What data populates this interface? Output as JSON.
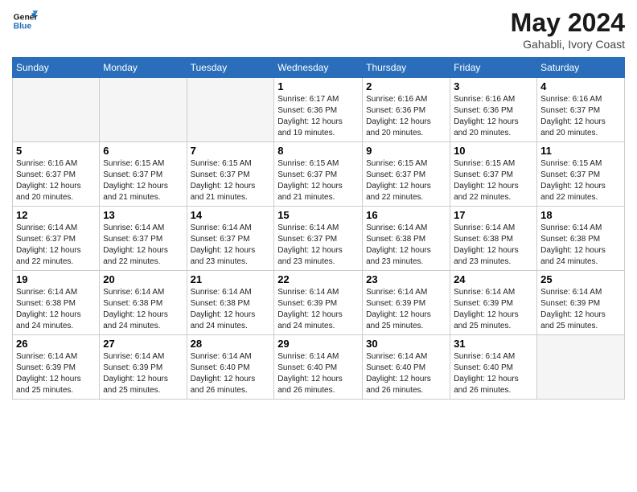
{
  "header": {
    "logo_line1": "General",
    "logo_line2": "Blue",
    "month": "May 2024",
    "location": "Gahabli, Ivory Coast"
  },
  "weekdays": [
    "Sunday",
    "Monday",
    "Tuesday",
    "Wednesday",
    "Thursday",
    "Friday",
    "Saturday"
  ],
  "weeks": [
    [
      {
        "day": "",
        "info": ""
      },
      {
        "day": "",
        "info": ""
      },
      {
        "day": "",
        "info": ""
      },
      {
        "day": "1",
        "info": "Sunrise: 6:17 AM\nSunset: 6:36 PM\nDaylight: 12 hours\nand 19 minutes."
      },
      {
        "day": "2",
        "info": "Sunrise: 6:16 AM\nSunset: 6:36 PM\nDaylight: 12 hours\nand 20 minutes."
      },
      {
        "day": "3",
        "info": "Sunrise: 6:16 AM\nSunset: 6:36 PM\nDaylight: 12 hours\nand 20 minutes."
      },
      {
        "day": "4",
        "info": "Sunrise: 6:16 AM\nSunset: 6:37 PM\nDaylight: 12 hours\nand 20 minutes."
      }
    ],
    [
      {
        "day": "5",
        "info": "Sunrise: 6:16 AM\nSunset: 6:37 PM\nDaylight: 12 hours\nand 20 minutes."
      },
      {
        "day": "6",
        "info": "Sunrise: 6:15 AM\nSunset: 6:37 PM\nDaylight: 12 hours\nand 21 minutes."
      },
      {
        "day": "7",
        "info": "Sunrise: 6:15 AM\nSunset: 6:37 PM\nDaylight: 12 hours\nand 21 minutes."
      },
      {
        "day": "8",
        "info": "Sunrise: 6:15 AM\nSunset: 6:37 PM\nDaylight: 12 hours\nand 21 minutes."
      },
      {
        "day": "9",
        "info": "Sunrise: 6:15 AM\nSunset: 6:37 PM\nDaylight: 12 hours\nand 22 minutes."
      },
      {
        "day": "10",
        "info": "Sunrise: 6:15 AM\nSunset: 6:37 PM\nDaylight: 12 hours\nand 22 minutes."
      },
      {
        "day": "11",
        "info": "Sunrise: 6:15 AM\nSunset: 6:37 PM\nDaylight: 12 hours\nand 22 minutes."
      }
    ],
    [
      {
        "day": "12",
        "info": "Sunrise: 6:14 AM\nSunset: 6:37 PM\nDaylight: 12 hours\nand 22 minutes."
      },
      {
        "day": "13",
        "info": "Sunrise: 6:14 AM\nSunset: 6:37 PM\nDaylight: 12 hours\nand 22 minutes."
      },
      {
        "day": "14",
        "info": "Sunrise: 6:14 AM\nSunset: 6:37 PM\nDaylight: 12 hours\nand 23 minutes."
      },
      {
        "day": "15",
        "info": "Sunrise: 6:14 AM\nSunset: 6:37 PM\nDaylight: 12 hours\nand 23 minutes."
      },
      {
        "day": "16",
        "info": "Sunrise: 6:14 AM\nSunset: 6:38 PM\nDaylight: 12 hours\nand 23 minutes."
      },
      {
        "day": "17",
        "info": "Sunrise: 6:14 AM\nSunset: 6:38 PM\nDaylight: 12 hours\nand 23 minutes."
      },
      {
        "day": "18",
        "info": "Sunrise: 6:14 AM\nSunset: 6:38 PM\nDaylight: 12 hours\nand 24 minutes."
      }
    ],
    [
      {
        "day": "19",
        "info": "Sunrise: 6:14 AM\nSunset: 6:38 PM\nDaylight: 12 hours\nand 24 minutes."
      },
      {
        "day": "20",
        "info": "Sunrise: 6:14 AM\nSunset: 6:38 PM\nDaylight: 12 hours\nand 24 minutes."
      },
      {
        "day": "21",
        "info": "Sunrise: 6:14 AM\nSunset: 6:38 PM\nDaylight: 12 hours\nand 24 minutes."
      },
      {
        "day": "22",
        "info": "Sunrise: 6:14 AM\nSunset: 6:39 PM\nDaylight: 12 hours\nand 24 minutes."
      },
      {
        "day": "23",
        "info": "Sunrise: 6:14 AM\nSunset: 6:39 PM\nDaylight: 12 hours\nand 25 minutes."
      },
      {
        "day": "24",
        "info": "Sunrise: 6:14 AM\nSunset: 6:39 PM\nDaylight: 12 hours\nand 25 minutes."
      },
      {
        "day": "25",
        "info": "Sunrise: 6:14 AM\nSunset: 6:39 PM\nDaylight: 12 hours\nand 25 minutes."
      }
    ],
    [
      {
        "day": "26",
        "info": "Sunrise: 6:14 AM\nSunset: 6:39 PM\nDaylight: 12 hours\nand 25 minutes."
      },
      {
        "day": "27",
        "info": "Sunrise: 6:14 AM\nSunset: 6:39 PM\nDaylight: 12 hours\nand 25 minutes."
      },
      {
        "day": "28",
        "info": "Sunrise: 6:14 AM\nSunset: 6:40 PM\nDaylight: 12 hours\nand 26 minutes."
      },
      {
        "day": "29",
        "info": "Sunrise: 6:14 AM\nSunset: 6:40 PM\nDaylight: 12 hours\nand 26 minutes."
      },
      {
        "day": "30",
        "info": "Sunrise: 6:14 AM\nSunset: 6:40 PM\nDaylight: 12 hours\nand 26 minutes."
      },
      {
        "day": "31",
        "info": "Sunrise: 6:14 AM\nSunset: 6:40 PM\nDaylight: 12 hours\nand 26 minutes."
      },
      {
        "day": "",
        "info": ""
      }
    ]
  ]
}
